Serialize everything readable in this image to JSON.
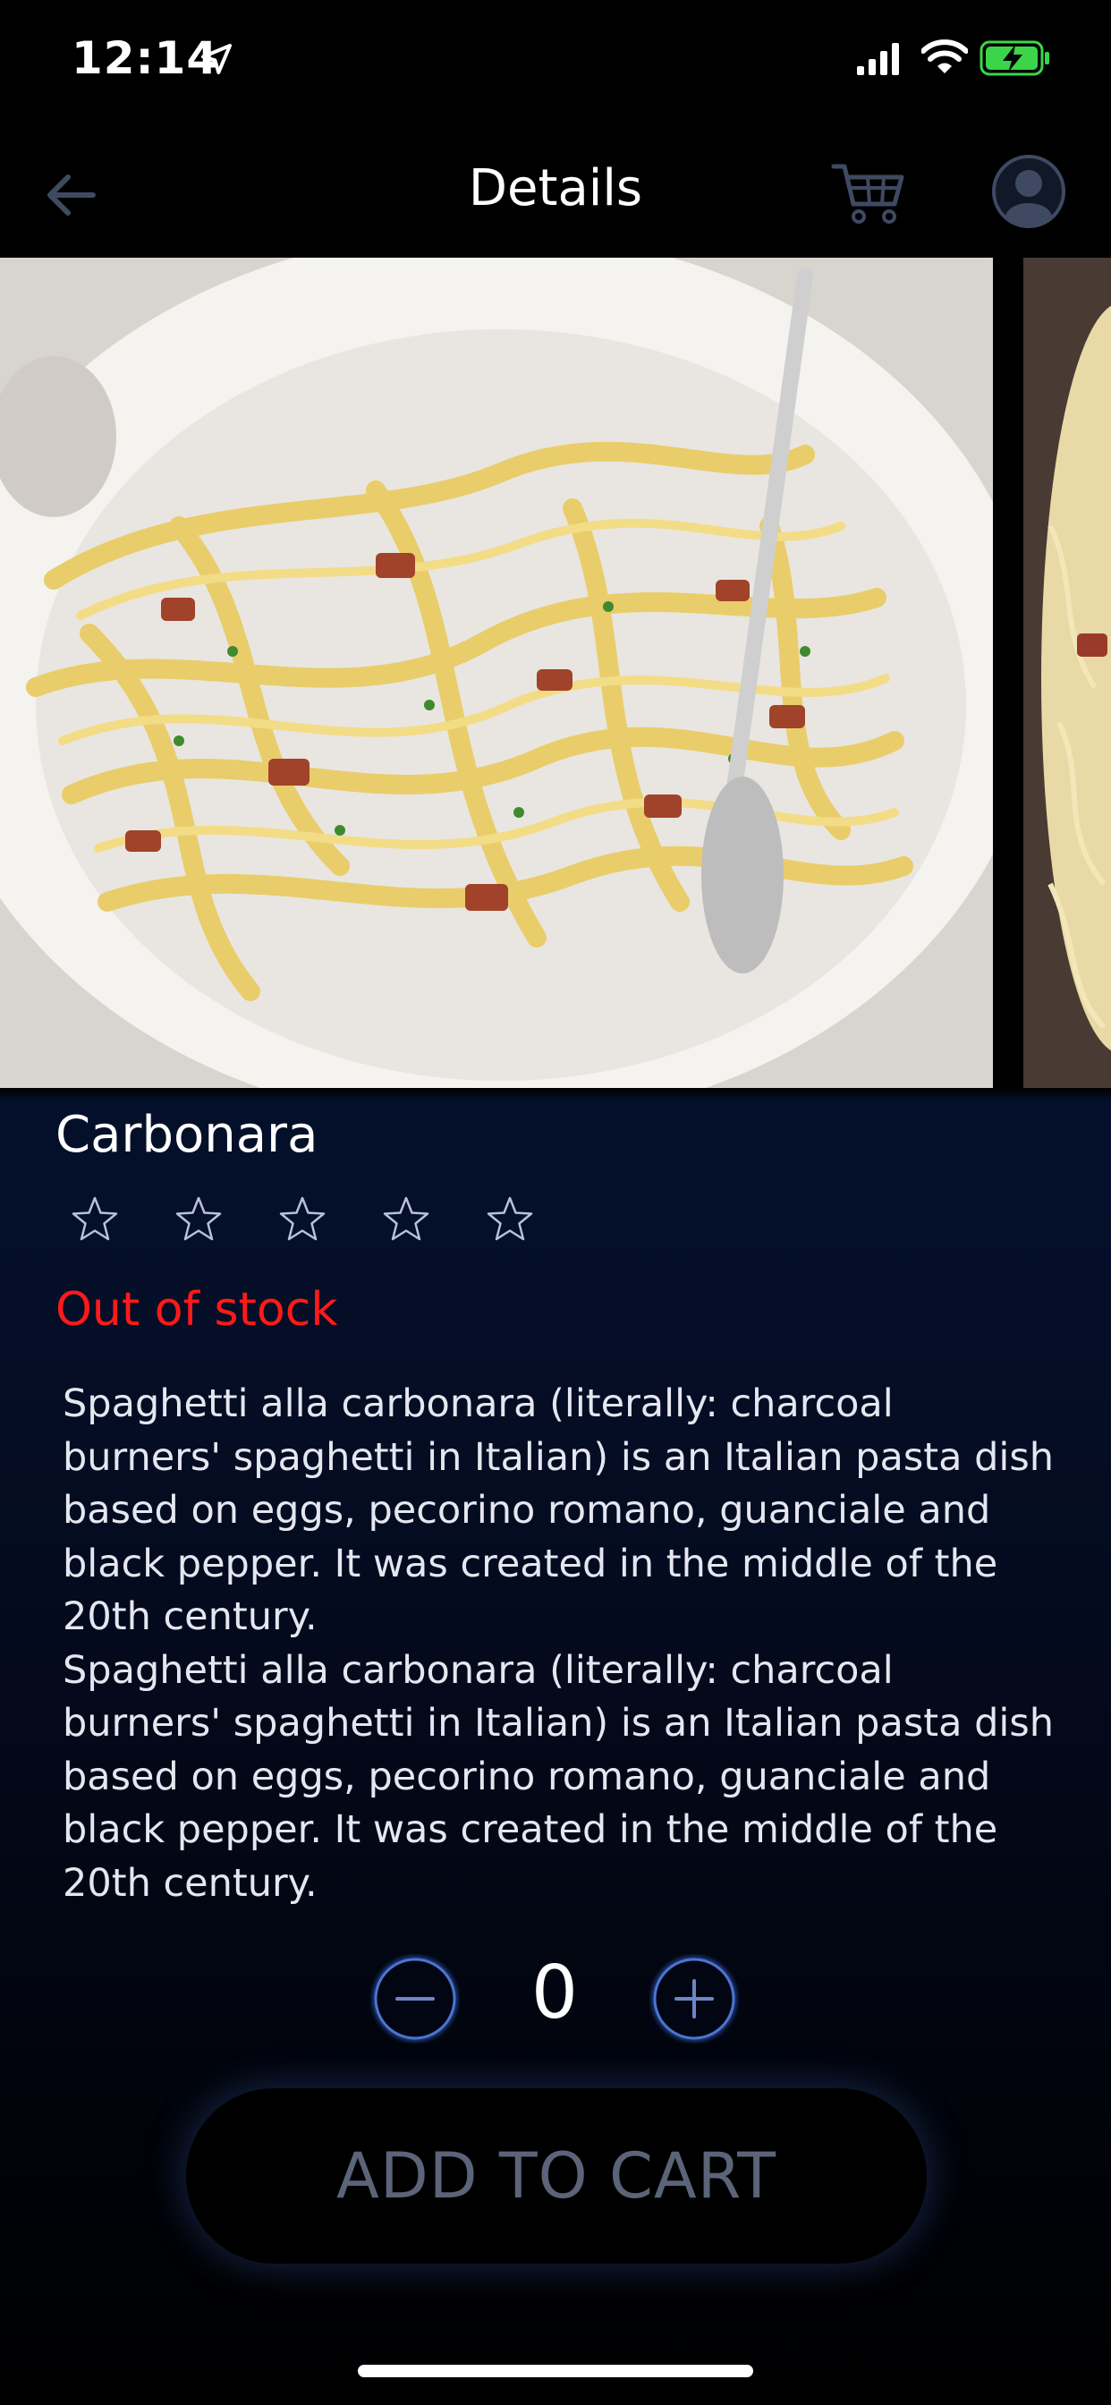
{
  "status_bar": {
    "time": "12:14",
    "location_icon": "location-arrow-icon",
    "signal_icon": "signal-icon",
    "wifi_icon": "wifi-icon",
    "battery_icon": "battery-charging-icon"
  },
  "nav": {
    "title": "Details",
    "back_icon": "arrow-left-icon",
    "cart_icon": "cart-icon",
    "profile_icon": "user-avatar-icon"
  },
  "product": {
    "name": "Carbonara",
    "rating": 0,
    "max_rating": 5,
    "stock_status": "Out of stock",
    "description": [
      "Spaghetti alla carbonara (literally: charcoal burners' spaghetti in Italian) is an Italian pasta dish based on eggs, pecorino romano, guanciale and black pepper. It was created in the middle of the 20th century.",
      "Spaghetti alla carbonara (literally: charcoal burners' spaghetti in Italian) is an Italian pasta dish based on eggs, pecorino romano, guanciale and black pepper. It was created in the middle of the 20th century."
    ]
  },
  "quantity": {
    "value": "0",
    "minus_icon": "minus-icon",
    "plus_icon": "plus-icon"
  },
  "actions": {
    "add_to_cart_label": "ADD TO CART"
  },
  "colors": {
    "accent": "#2f56b8",
    "stock_status": "#ff1a1a",
    "disabled_text": "#5b6478"
  }
}
